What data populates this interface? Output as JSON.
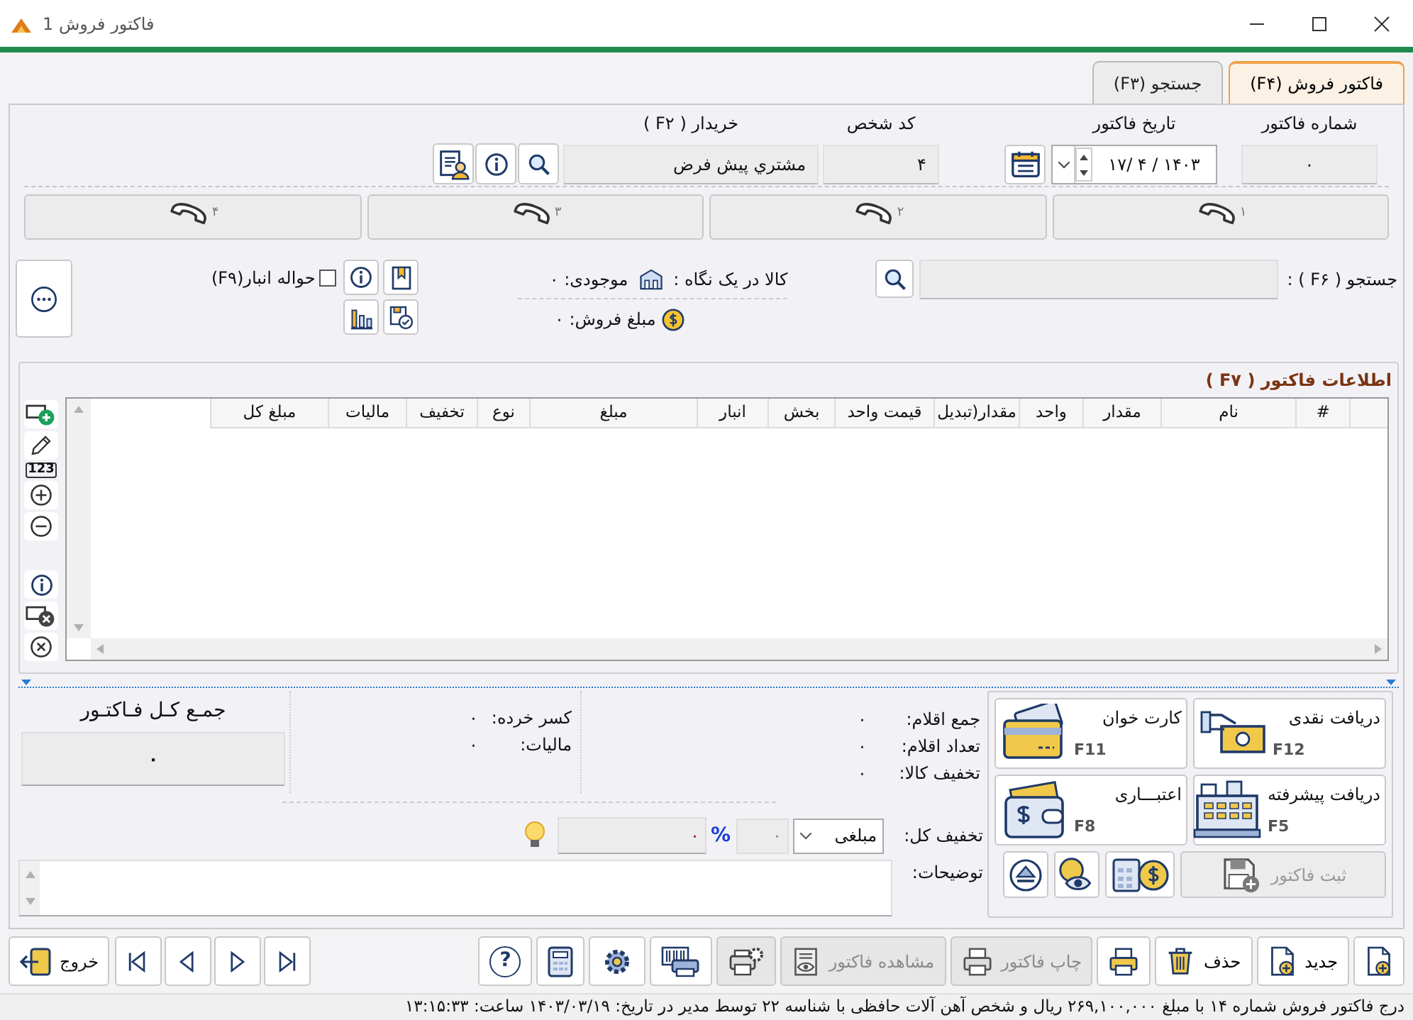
{
  "window": {
    "title": "فاکتور فروش 1"
  },
  "tabs": [
    {
      "label": "فاکتور فروش (F۴)",
      "selected": true
    },
    {
      "label": "جستجو (F۳)",
      "selected": false
    }
  ],
  "header": {
    "invoice_number": {
      "label": "شماره فاکتور",
      "value": "۰"
    },
    "invoice_date": {
      "label": "تاریخ فاکتور",
      "value": "۱۷/ ۴ / ۱۴۰۳"
    },
    "person_code": {
      "label": "کد شخص",
      "value": "۴"
    },
    "buyer": {
      "label": "خریدار ( F۲ )",
      "value": "مشتري پيش فرض"
    }
  },
  "phone_lines": [
    "۱",
    "۲",
    "۳",
    "۴"
  ],
  "search": {
    "label": "جستجو ( F۶ ) :"
  },
  "product_glance": {
    "label": "کالا در یک نگاه :",
    "stock": "موجودی: ۰",
    "sale_amount": "مبلغ فروش: ۰"
  },
  "warehouse_transfer": {
    "label": "حواله انبار(F۹)",
    "checked": false
  },
  "invoice_info": {
    "title": "اطلاعات فاکتور ( F۷ )",
    "numbering_label": "123",
    "columns": [
      "#",
      "نام",
      "مقدار",
      "واحد",
      "مقدار(تبدیل",
      "قیمت واحد",
      "بخش",
      "انبار",
      "مبلغ",
      "نوع",
      "تخفیف",
      "مالیات",
      "مبلغ کل"
    ]
  },
  "totals": {
    "items_sum": {
      "label": "جمع اقلام:",
      "value": "۰"
    },
    "items_count": {
      "label": "تعداد اقلام:",
      "value": "۰"
    },
    "item_discount": {
      "label": "تخفیف کالا:",
      "value": "۰"
    },
    "rounding": {
      "label": "کسر خرده:",
      "value": "۰"
    },
    "tax": {
      "label": "مالیات:",
      "value": "۰"
    },
    "grand_total_title": "جمـع کـل فـاکتـور",
    "grand_total": "۰"
  },
  "discount": {
    "label": "تخفیف کل:",
    "type": "مبلغی",
    "percent": "۰",
    "percent_sign": "%",
    "amount": "۰"
  },
  "notes": {
    "label": "توضیحات:"
  },
  "payment_buttons": [
    {
      "kind": "cash",
      "label": "دریافت نقدی",
      "key": "F12"
    },
    {
      "kind": "card",
      "label": "کارت خوان",
      "key": "F11"
    },
    {
      "kind": "register",
      "label": "دریافت پیشرفته",
      "key": "F5"
    },
    {
      "kind": "wallet",
      "label": "اعتبـــاری",
      "key": "F8"
    }
  ],
  "save_button": {
    "label": "ثبت فاکتور",
    "disabled": true
  },
  "toolbar": [
    {
      "kind": "new_doc",
      "disabled": false
    },
    {
      "kind": "new",
      "label": "جدید",
      "disabled": false
    },
    {
      "kind": "delete",
      "label": "حذف",
      "disabled": false
    },
    {
      "kind": "print",
      "disabled": false
    },
    {
      "kind": "print_invoice",
      "label": "چاپ فاکتور",
      "disabled": true
    },
    {
      "kind": "view_invoice",
      "label": "مشاهده فاکتور",
      "disabled": true
    },
    {
      "kind": "print_settings",
      "disabled": true
    },
    {
      "kind": "barcode",
      "disabled": false
    },
    {
      "kind": "settings",
      "disabled": false
    },
    {
      "kind": "calculator",
      "disabled": false
    },
    {
      "kind": "help",
      "label": "?",
      "disabled": false
    }
  ],
  "navigation": [
    {
      "kind": "last"
    },
    {
      "kind": "next"
    },
    {
      "kind": "previous"
    },
    {
      "kind": "first"
    }
  ],
  "exit_button": {
    "label": "خروج"
  },
  "status_bar": "درج فاکتور فروش شماره ۱۴ با مبلغ ۲۶۹,۱۰۰,۰۰۰ ریال و شخص آهن آلات حافظی با شناسه ۲۲ توسط مدیر در تاریخ: ۱۴۰۳/۰۳/۱۹ ساعت: ۱۳:۱۵:۳۳"
}
